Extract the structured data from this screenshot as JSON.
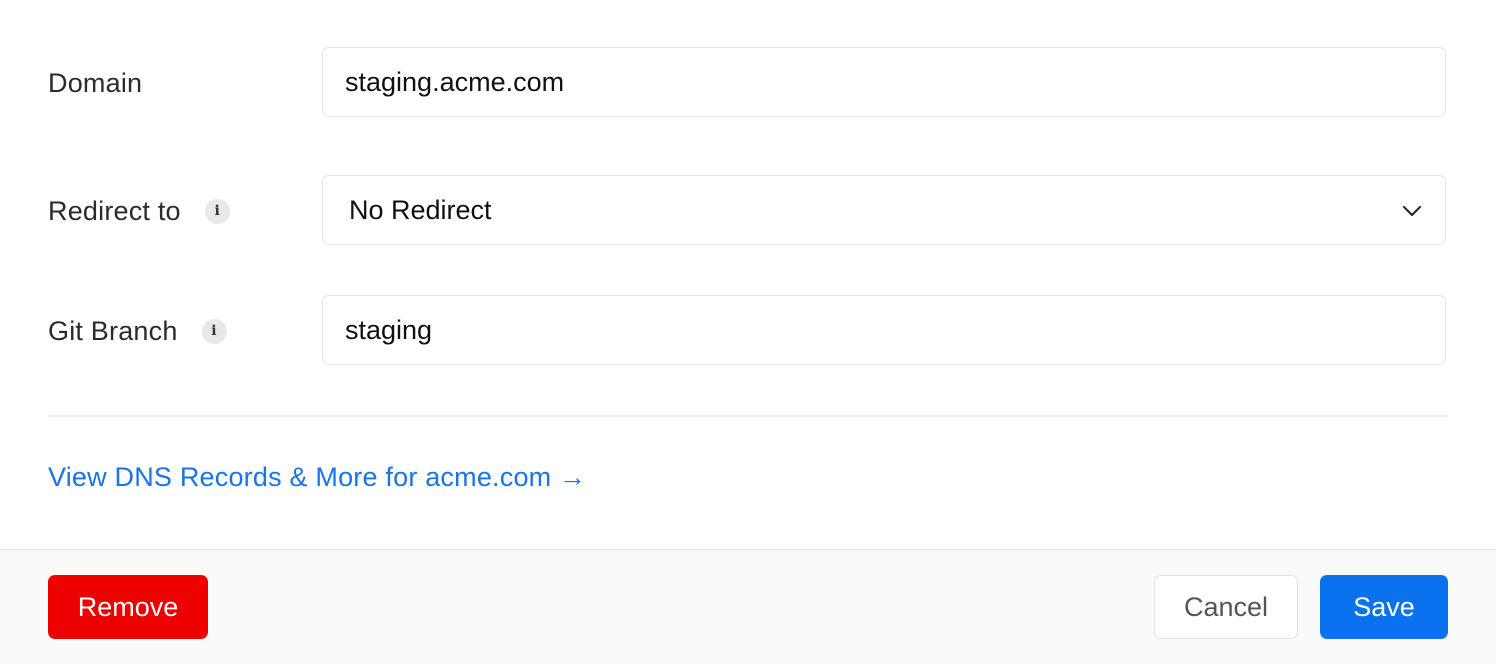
{
  "form": {
    "domain": {
      "label": "Domain",
      "value": "staging.acme.com"
    },
    "redirect": {
      "label": "Redirect to",
      "info_icon": "i",
      "selected": "No Redirect"
    },
    "git_branch": {
      "label": "Git Branch",
      "info_icon": "i",
      "value": "staging"
    }
  },
  "dns_link": {
    "text": "View DNS Records & More for acme.com →"
  },
  "footer": {
    "remove_label": "Remove",
    "cancel_label": "Cancel",
    "save_label": "Save"
  },
  "colors": {
    "link": "#1a73e8",
    "danger": "#ee0000",
    "primary": "#0a72ef"
  },
  "icons": {
    "info": "info-icon",
    "dropdown": "chevron-down-icon"
  }
}
